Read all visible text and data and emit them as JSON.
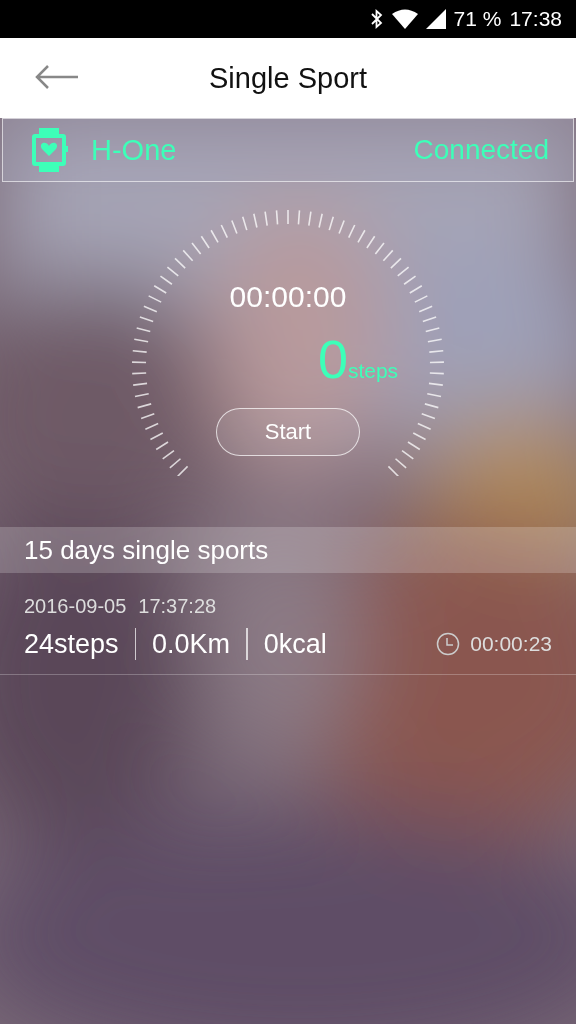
{
  "status_bar": {
    "battery": "71 %",
    "time": "17:38"
  },
  "header": {
    "title": "Single Sport"
  },
  "device": {
    "name": "H-One",
    "status": "Connected"
  },
  "timer": {
    "elapsed": "00:00:00",
    "steps": "0",
    "steps_unit": "steps",
    "button": "Start"
  },
  "history": {
    "title": "15 days single sports",
    "records": [
      {
        "date": "2016-09-05",
        "time": "17:37:28",
        "steps": "24steps",
        "distance": "0.0Km",
        "calories": "0kcal",
        "duration": "00:00:23"
      }
    ]
  }
}
